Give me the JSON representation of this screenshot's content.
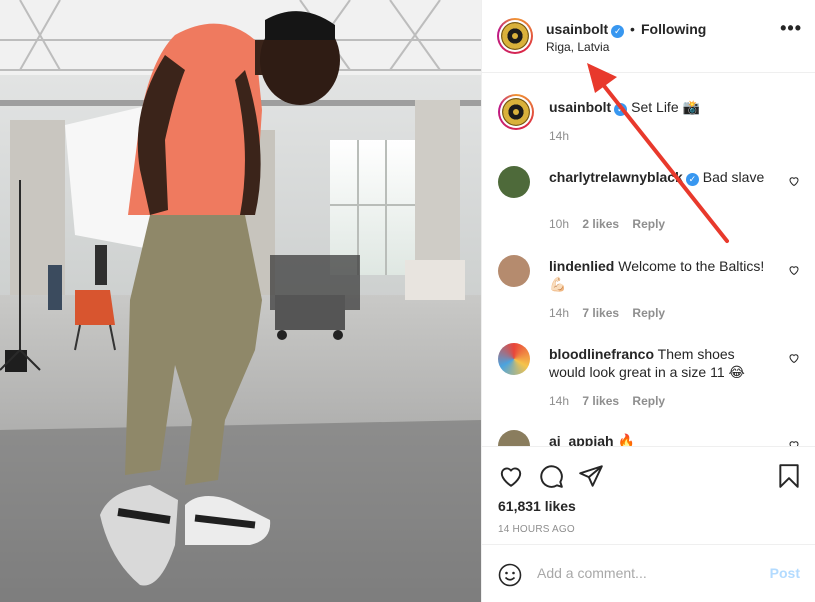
{
  "header": {
    "username": "usainbolt",
    "verified_icon": "verified-badge-icon",
    "dot": "•",
    "follow_label": "Following",
    "location": "Riga, Latvia",
    "more_label": "•••"
  },
  "comments": [
    {
      "username": "usainbolt",
      "verified": true,
      "text": "Set Life 📸",
      "time": "14h",
      "likes": "",
      "reply": ""
    },
    {
      "username": "charlytrelawnyblack",
      "verified": true,
      "text": "Bad slave",
      "time": "10h",
      "likes": "2 likes",
      "reply": "Reply"
    },
    {
      "username": "lindenlied",
      "verified": false,
      "text": "Welcome to the Baltics!💪🏻",
      "time": "14h",
      "likes": "7 likes",
      "reply": "Reply"
    },
    {
      "username": "bloodlinefranco",
      "verified": false,
      "text": "Them shoes would look great in a size 11 😂",
      "time": "14h",
      "likes": "7 likes",
      "reply": "Reply"
    },
    {
      "username": "aj_appiah",
      "verified": false,
      "text": "🔥",
      "time": "",
      "likes": "",
      "reply": ""
    }
  ],
  "actions": {
    "like_icon": "heart-icon",
    "comment_icon": "comment-icon",
    "share_icon": "share-icon",
    "save_icon": "bookmark-icon",
    "likes": "61,831 likes",
    "time_ago": "14 HOURS AGO"
  },
  "add_comment": {
    "emoji_icon": "emoji-icon",
    "placeholder": "Add a comment...",
    "post_label": "Post"
  },
  "colors": {
    "link_blue": "#3897f0",
    "post_disabled": "#b3dbff",
    "arrow_red": "#e8392c",
    "shirt": "#ef7a5f"
  }
}
